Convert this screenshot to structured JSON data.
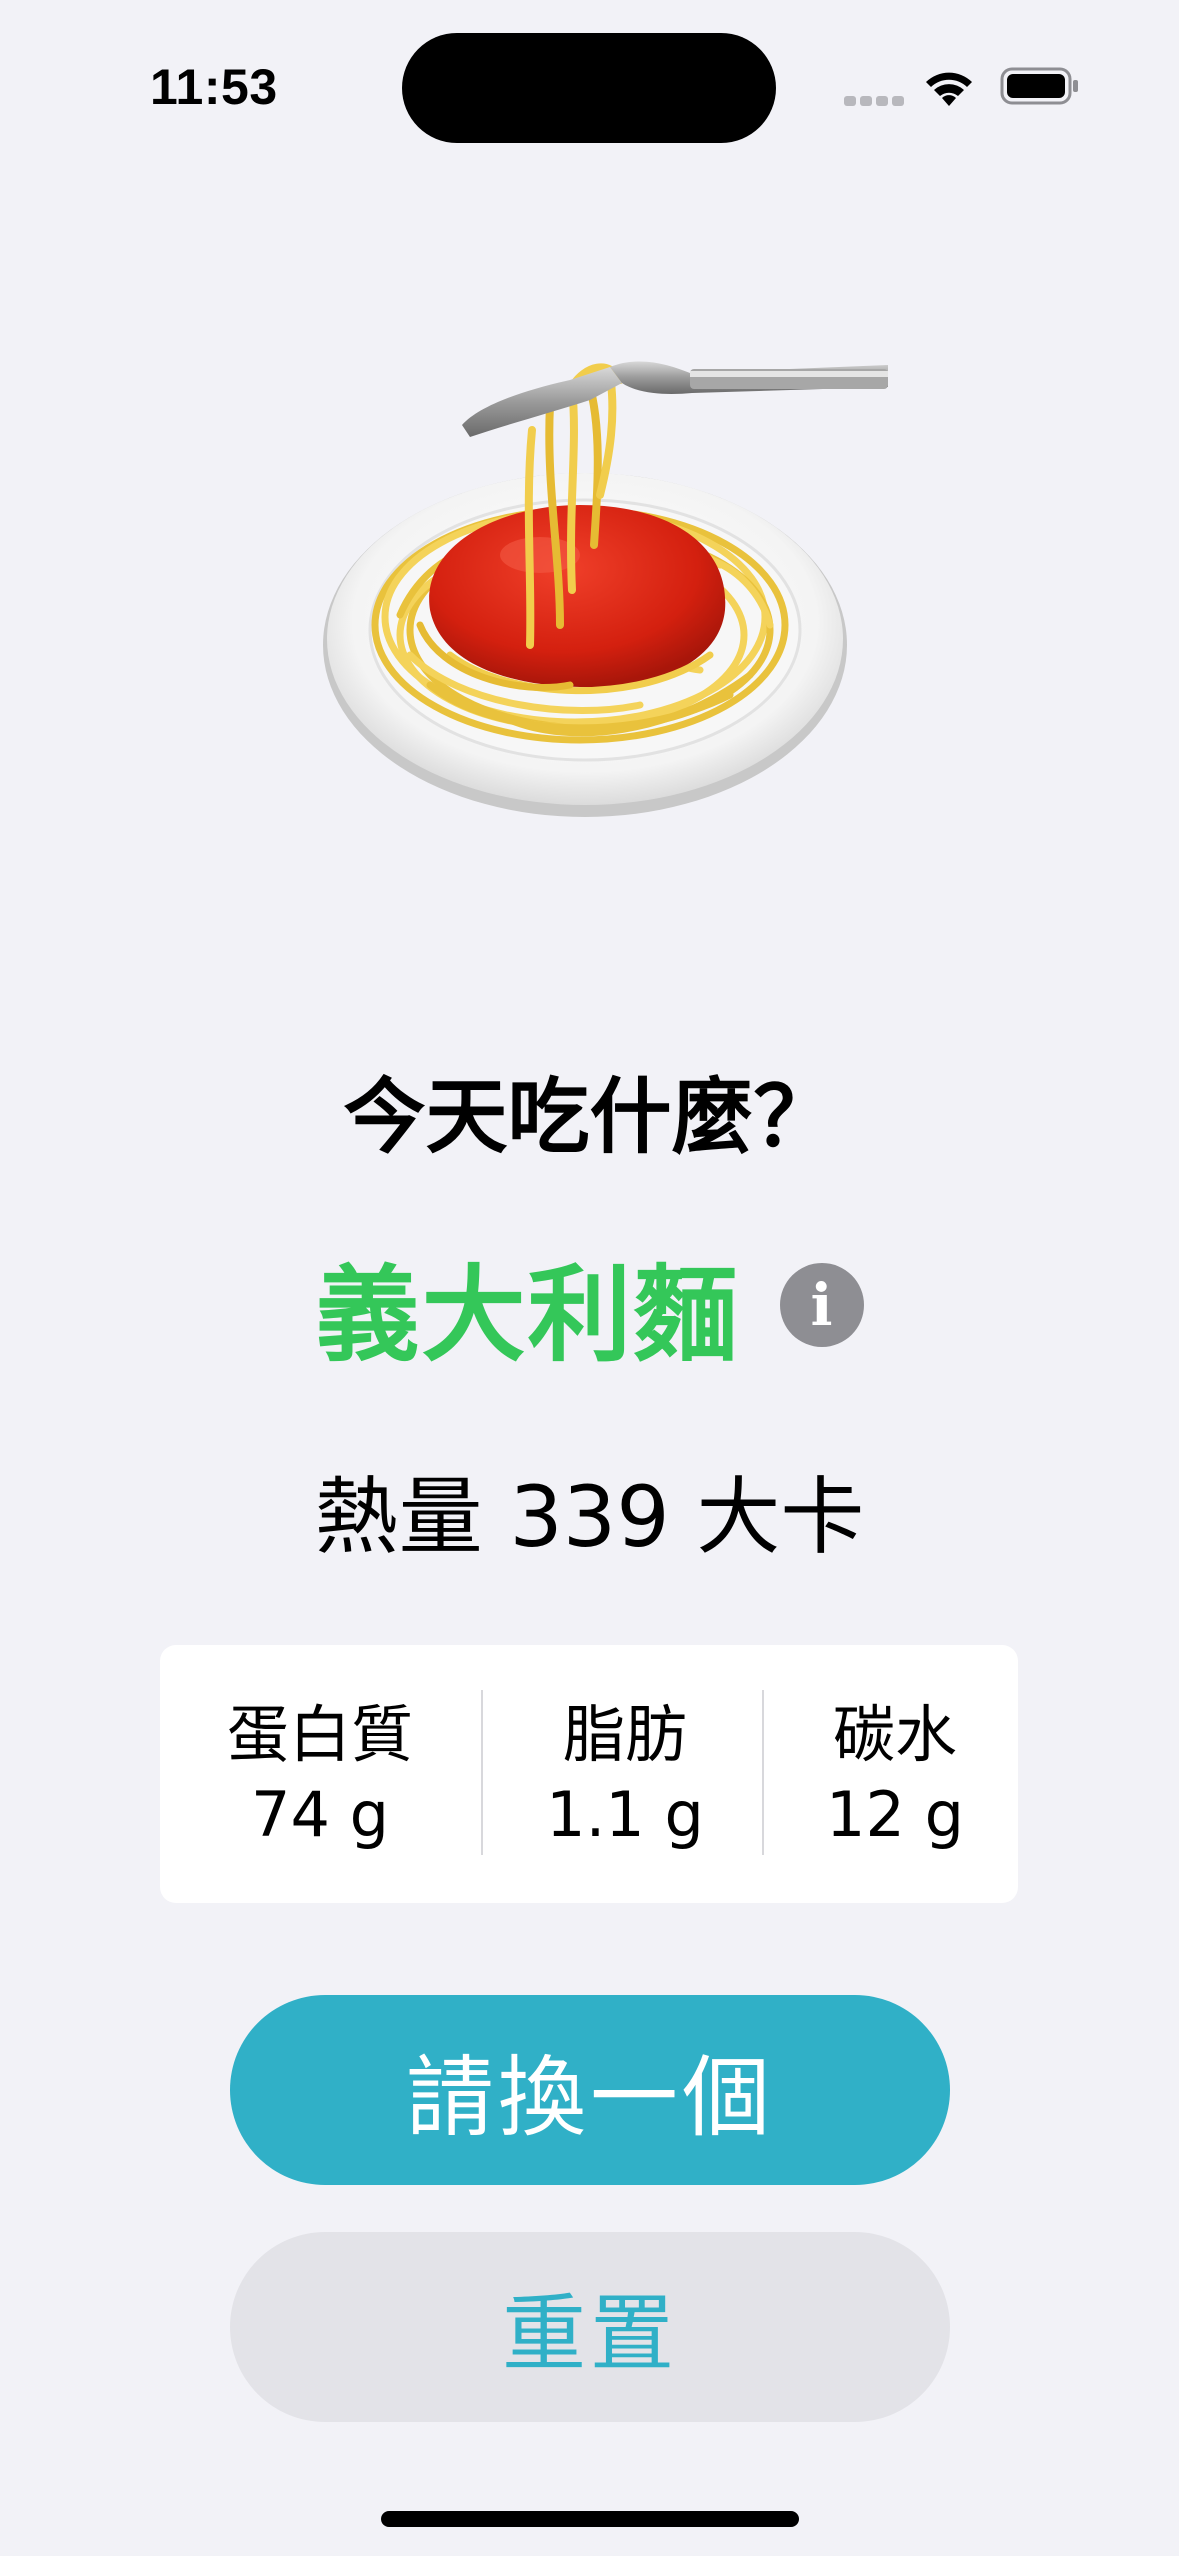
{
  "status_bar": {
    "time": "11:53",
    "wifi_icon": "wifi-icon",
    "battery_icon": "battery-icon",
    "signal_icon": "cellular-signal-icon"
  },
  "food_image": {
    "icon": "spaghetti-emoji"
  },
  "question": "今天吃什麼？",
  "food": {
    "name": "義大利麵",
    "name_color": "#34c759",
    "info_icon": "info-icon",
    "info_glyph": "i"
  },
  "calories": {
    "text": "熱量 339 大卡"
  },
  "nutrition": [
    {
      "label": "蛋白質",
      "value": "74 g"
    },
    {
      "label": "脂肪",
      "value": "1.1 g"
    },
    {
      "label": "碳水",
      "value": "12 g"
    }
  ],
  "buttons": {
    "change": "請換一個",
    "reset": "重置",
    "accent_color": "#30b0c7"
  }
}
